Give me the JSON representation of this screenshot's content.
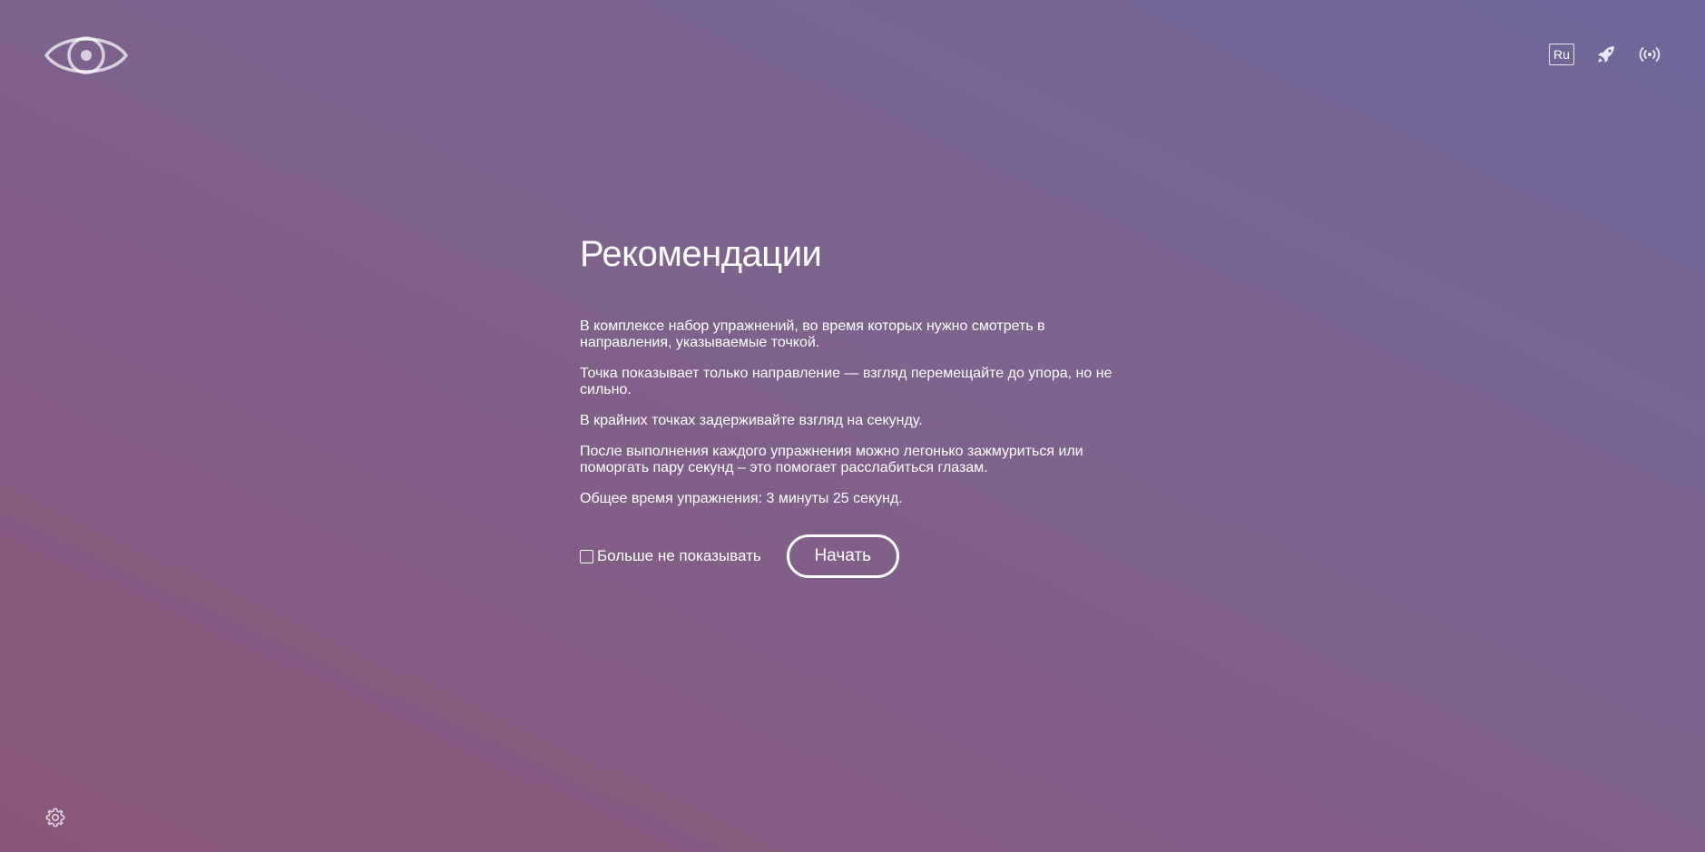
{
  "header": {
    "logo_icon": "eye-icon",
    "language_label": "Ru",
    "icons": [
      "rocket-icon",
      "broadcast-icon"
    ]
  },
  "main": {
    "title": "Рекомендации",
    "paragraphs": [
      "В комплексе набор упражнений, во время которых нужно смотреть в направления, указываемые точкой.",
      "Точка показывает только направление — взгляд перемещайте до упора, но не сильно.",
      "В крайних точках задерживайте взгляд на секунду.",
      "После выполнения каждого упражнения можно легонько зажмуриться или поморгать пару секунд – это помогает расслабиться глазам.",
      "Общее время упражнения: 3 минуты 25 секунд."
    ],
    "checkbox_label": "Больше не показывать",
    "checkbox_checked": false,
    "start_label": "Начать"
  },
  "footer": {
    "settings_icon": "gear-icon"
  },
  "colors": {
    "background_top_right": "#6f679b",
    "background_bottom_left": "#8a5677",
    "foreground": "#ffffff"
  }
}
